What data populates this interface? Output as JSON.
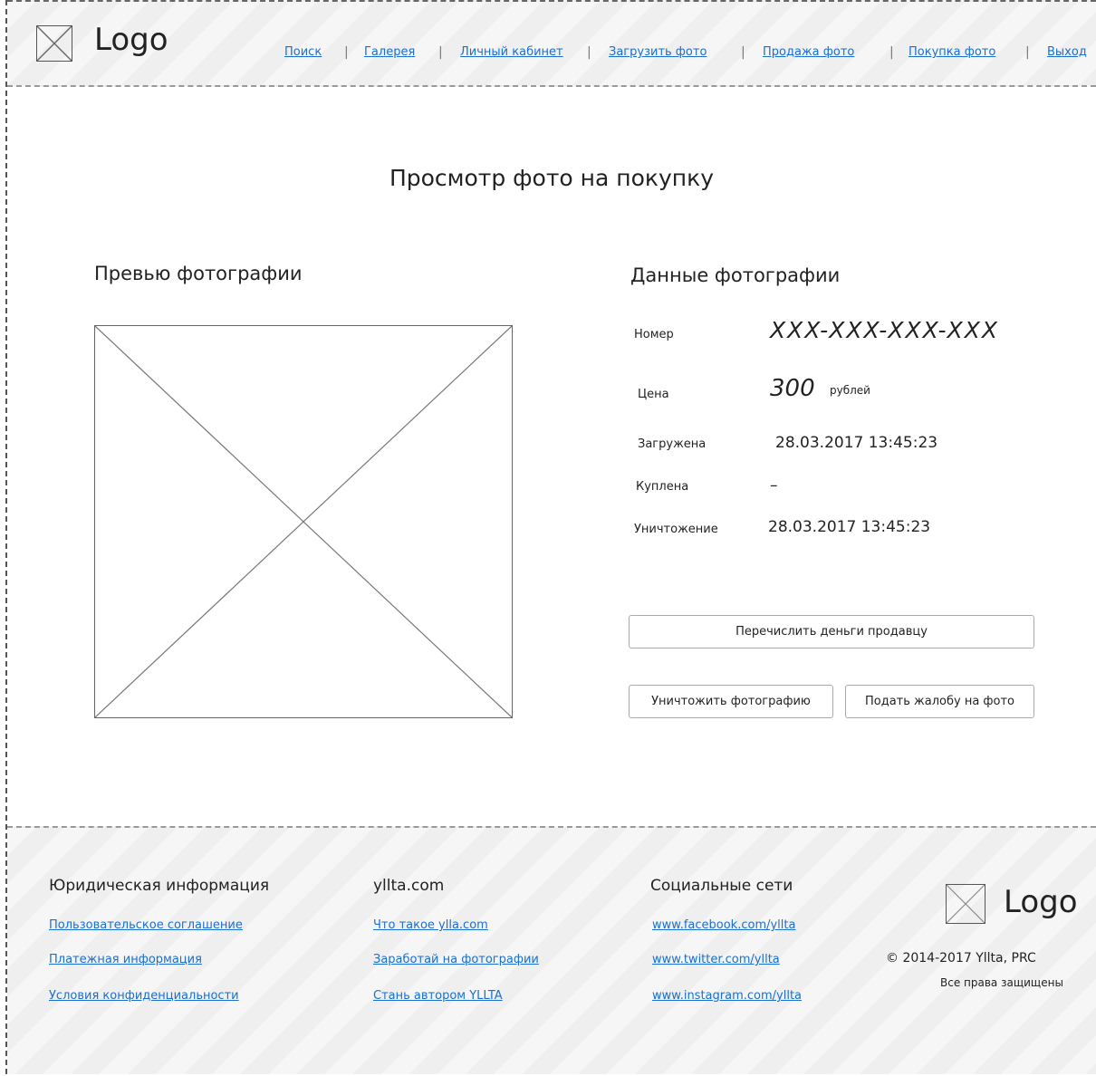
{
  "header": {
    "logo_text": "Logo",
    "nav": [
      "Поиск",
      "Галерея",
      "Личный кабинет",
      "Загрузить фото",
      "Продажа фото",
      "Покупка фото",
      "Выход"
    ]
  },
  "main": {
    "page_title": "Просмотр фото на покупку",
    "preview_title": "Превью фотографии",
    "data_title": "Данные фотографии",
    "fields": {
      "number_label": "Номер",
      "number_value": "XXX-XXX-XXX-XXX",
      "price_label": "Цена",
      "price_value": "300",
      "price_unit": "рублей",
      "uploaded_label": "Загружена",
      "uploaded_value": "28.03.2017 13:45:23",
      "bought_label": "Куплена",
      "bought_value": "–",
      "destroy_label": "Уничтожение",
      "destroy_value": "28.03.2017 13:45:23"
    },
    "buttons": {
      "transfer": "Перечислить деньги продавцу",
      "destroy": "Уничтожить фотографию",
      "complain": "Подать жалобу на фото"
    }
  },
  "footer": {
    "legal": {
      "heading": "Юридическая информация",
      "links": [
        "Пользовательское соглашение",
        "Платежная информация",
        "Условия конфиденциальности"
      ]
    },
    "site": {
      "heading": "yllta.com",
      "links": [
        "Что такое ylla.com",
        "Заработай на фотографии",
        "Стань автором YLLTA"
      ]
    },
    "social": {
      "heading": "Социальные сети",
      "links": [
        "www.facebook.com/yllta",
        "www.twitter.com/yllta",
        "www.instagram.com/yllta"
      ]
    },
    "logo_text": "Logo",
    "copyright": "© 2014-2017 Yllta, PRC",
    "rights": "Все права защищены"
  }
}
